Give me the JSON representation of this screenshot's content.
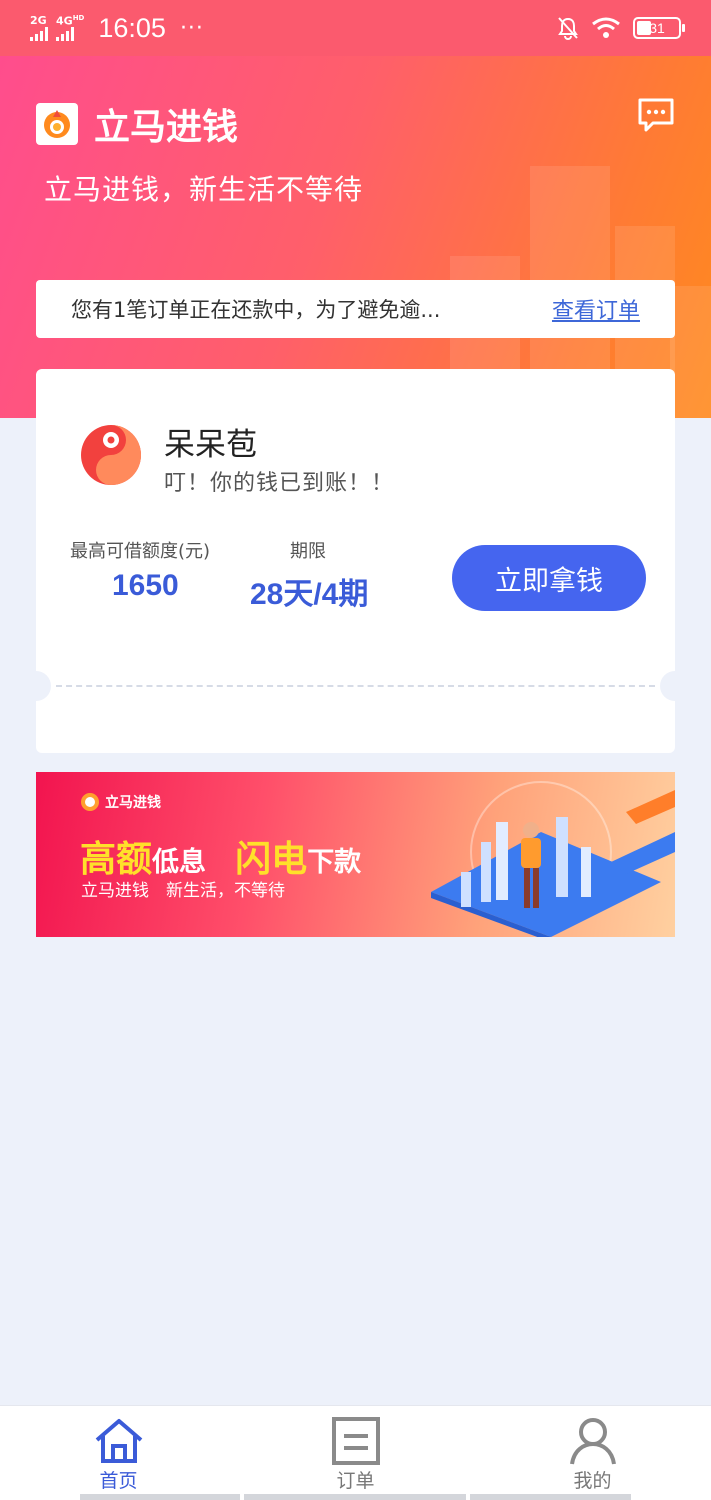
{
  "status_bar": {
    "net1": "2G",
    "net2": "4G",
    "net2_sup": "HD",
    "time": "16:05",
    "dots": "···",
    "battery": "31"
  },
  "header": {
    "app_title": "立马进钱",
    "slogan": "立马进钱，新生活不等待",
    "notice_text": "您有1笔订单正在还款中，为了避免逾...",
    "notice_link": "查看订单"
  },
  "card": {
    "name": "呆呆苞",
    "subtitle": "叮！你的钱已到账！！",
    "limit_label": "最高可借额度(元)",
    "limit_value": "1650",
    "term_label": "期限",
    "term_value": "28天/4期",
    "button": "立即拿钱"
  },
  "banner": {
    "brand": "立马进钱",
    "h1": "高额",
    "h2": "低息",
    "h3": "闪电",
    "h4": "下款",
    "sub": "立马进钱　新生活，不等待"
  },
  "nav": {
    "items": [
      {
        "label": "首页",
        "icon": "home-icon",
        "active": true
      },
      {
        "label": "订单",
        "icon": "order-icon",
        "active": false
      },
      {
        "label": "我的",
        "icon": "user-icon",
        "active": false
      }
    ]
  },
  "colors": {
    "primary": "#4565ef",
    "accent_link": "#3d67d8",
    "header_start": "#ff4d8d",
    "header_end": "#ff8a1e"
  }
}
